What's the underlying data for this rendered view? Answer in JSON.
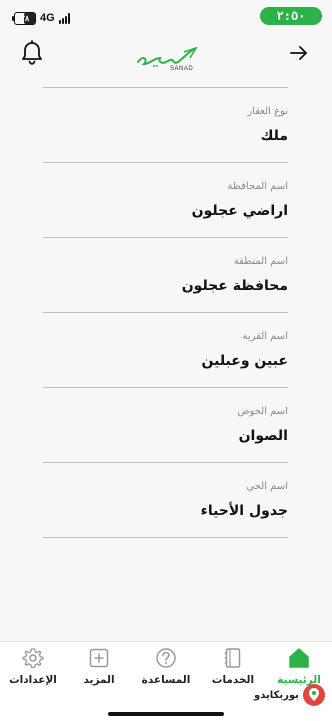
{
  "status": {
    "time": "٢:٥٠",
    "battery": "٢٨",
    "network": "4G",
    "signal_bars": 4
  },
  "header": {
    "logo_text": "SANAD",
    "bell_icon": "bell-icon",
    "back_icon": "arrow-right-icon"
  },
  "fields": [
    {
      "label": "نوع العقار",
      "value": "ملك"
    },
    {
      "label": "اسم المحافظة",
      "value": "اراضي عجلون"
    },
    {
      "label": "اسم المنطقة",
      "value": "محافظة عجلون"
    },
    {
      "label": "اسم القرية",
      "value": "عبين وعبلين"
    },
    {
      "label": "اسم الحوض",
      "value": "الصوان"
    },
    {
      "label": "اسم الحي",
      "value": "جدول الأحياء"
    }
  ],
  "nav": {
    "settings": "الإعدادات",
    "more": "المزيد",
    "help": "المساعدة",
    "services": "الخدمات",
    "home": "الرئيسية",
    "accent": "#2db24a"
  },
  "watermark": "بوربكايدو"
}
